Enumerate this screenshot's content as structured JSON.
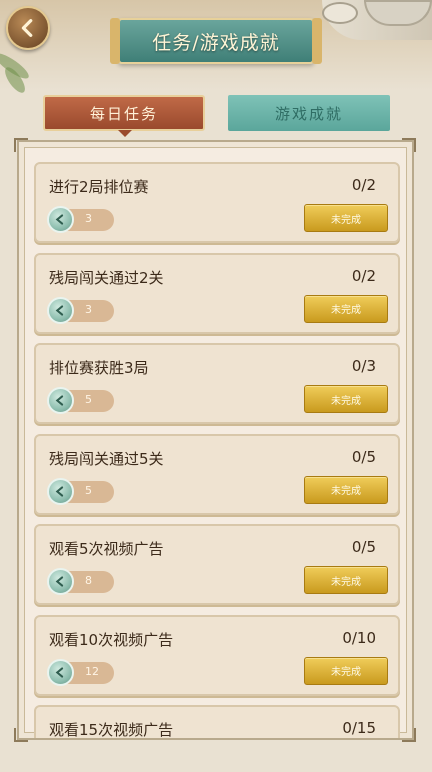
{
  "header": {
    "title": "任务/游戏成就"
  },
  "tabs": [
    {
      "label": "每日任务",
      "active": true
    },
    {
      "label": "游戏成就",
      "active": false
    }
  ],
  "status_label": "未完成",
  "tasks": [
    {
      "name": "进行2局排位赛",
      "progress": "0/2",
      "reward": "3"
    },
    {
      "name": "残局闯关通过2关",
      "progress": "0/2",
      "reward": "3"
    },
    {
      "name": "排位赛获胜3局",
      "progress": "0/3",
      "reward": "5"
    },
    {
      "name": "残局闯关通过5关",
      "progress": "0/5",
      "reward": "5"
    },
    {
      "name": "观看5次视频广告",
      "progress": "0/5",
      "reward": "8"
    },
    {
      "name": "观看10次视频广告",
      "progress": "0/10",
      "reward": "12"
    },
    {
      "name": "观看15次视频广告",
      "progress": "0/15",
      "reward": ""
    }
  ],
  "colors": {
    "active_tab": "#a9543a",
    "inactive_tab": "#6bb5aa",
    "status_button": "#d9aa2a"
  }
}
